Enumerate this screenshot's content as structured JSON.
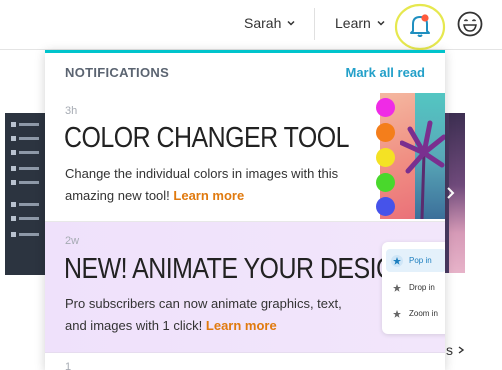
{
  "header": {
    "user_label": "Sarah",
    "learn_label": "Learn"
  },
  "notifications": {
    "title": "NOTIFICATIONS",
    "mark_all_label": "Mark all read",
    "items": [
      {
        "time": "3h",
        "title": "COLOR CHANGER TOOL",
        "body": "Change the individual colors in images with this amazing new tool!",
        "link": "Learn more",
        "swatches": [
          "#ef2be6",
          "#f47e1b",
          "#f4e224",
          "#49d82c",
          "#4653ea"
        ]
      },
      {
        "time": "2w",
        "title": "NEW! ANIMATE YOUR DESIGNS",
        "body": "Pro subscribers can now animate graphics, text, and images with 1 click!",
        "link": "Learn more",
        "animations": [
          "Pop in",
          "Drop in",
          "Zoom in"
        ]
      },
      {
        "time": "1"
      }
    ]
  },
  "background": {
    "editor_menu": [
      "EDITS",
      "TOUCH UP",
      "EFFECTS",
      "TEXTURES",
      "FRAMES",
      "TEMPLATES",
      "THEMES",
      "COMMENTS"
    ],
    "link_fragment": "s"
  },
  "colors": {
    "accent": "#00c4cc",
    "link_blue": "#23a0c9",
    "learn_orange": "#e07a0f",
    "bell_highlight": "#e8e85a"
  }
}
